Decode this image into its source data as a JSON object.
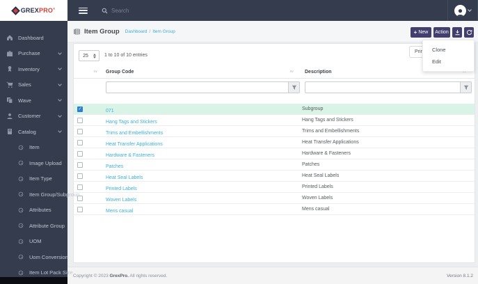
{
  "brand": {
    "name_primary": "GREX",
    "name_secondary": "PRO",
    "trademark": "®"
  },
  "topbar": {
    "search_placeholder": "Search"
  },
  "sidebar": {
    "items": [
      {
        "label": "Dashboard"
      },
      {
        "label": "Purchase"
      },
      {
        "label": "Inventory"
      },
      {
        "label": "Sales"
      },
      {
        "label": "Wave"
      },
      {
        "label": "Customer"
      },
      {
        "label": "Catalog"
      }
    ],
    "subitems": [
      "Item",
      "Image Upload",
      "Item Type",
      "Item Group/Subgroup",
      "Attributes",
      "Attribute Group",
      "UOM",
      "Uom Conversion",
      "Item Lot Pack Size"
    ]
  },
  "page": {
    "title": "Item Group",
    "breadcrumb_parent": "Dashboard",
    "breadcrumb_separator": "/",
    "breadcrumb_current": "Item Group"
  },
  "toolbar": {
    "new_label": "New",
    "action_label": "Action",
    "print_label": "Print",
    "menu": [
      "Clone",
      "Edit"
    ]
  },
  "list_controls": {
    "page_size": "25",
    "entries_info": "1 to 10 of 10 entries"
  },
  "table": {
    "columns": [
      {
        "label": "Group Code"
      },
      {
        "label": "Description"
      }
    ],
    "rows": [
      {
        "code": "071",
        "description": "Subgroup",
        "selected": true
      },
      {
        "code": "Hang Tags and Stickers",
        "description": "Hang Tags and Stickers",
        "selected": false
      },
      {
        "code": "Trims and Embellishments",
        "description": "Trims and Embellishments",
        "selected": false
      },
      {
        "code": "Heat Transfer Applications",
        "description": "Heat Transfer Applications",
        "selected": false
      },
      {
        "code": "Hardware & Fasteners",
        "description": "Hardware & Fasteners",
        "selected": false
      },
      {
        "code": "Patches",
        "description": "Patches",
        "selected": false
      },
      {
        "code": "Heat Seal Labels",
        "description": "Heat Seal Labels",
        "selected": false
      },
      {
        "code": "Printed Labels",
        "description": "Printed Labels",
        "selected": false
      },
      {
        "code": "Woven Labels",
        "description": "Woven Labels",
        "selected": false
      },
      {
        "code": "Mens casual",
        "description": "Mens casual",
        "selected": false
      }
    ]
  },
  "footer": {
    "copyright": "Copyright © 2023",
    "brand": "GrexPro.",
    "rights": "All rights reserved.",
    "version": "Version 8.1.2"
  },
  "colors": {
    "sidebar_bg": "#353c4e",
    "accent": "#423e6e",
    "link": "#3bafda",
    "selected_row_bg": "#d9f3e6",
    "checkbox_checked": "#2d7dd2"
  }
}
